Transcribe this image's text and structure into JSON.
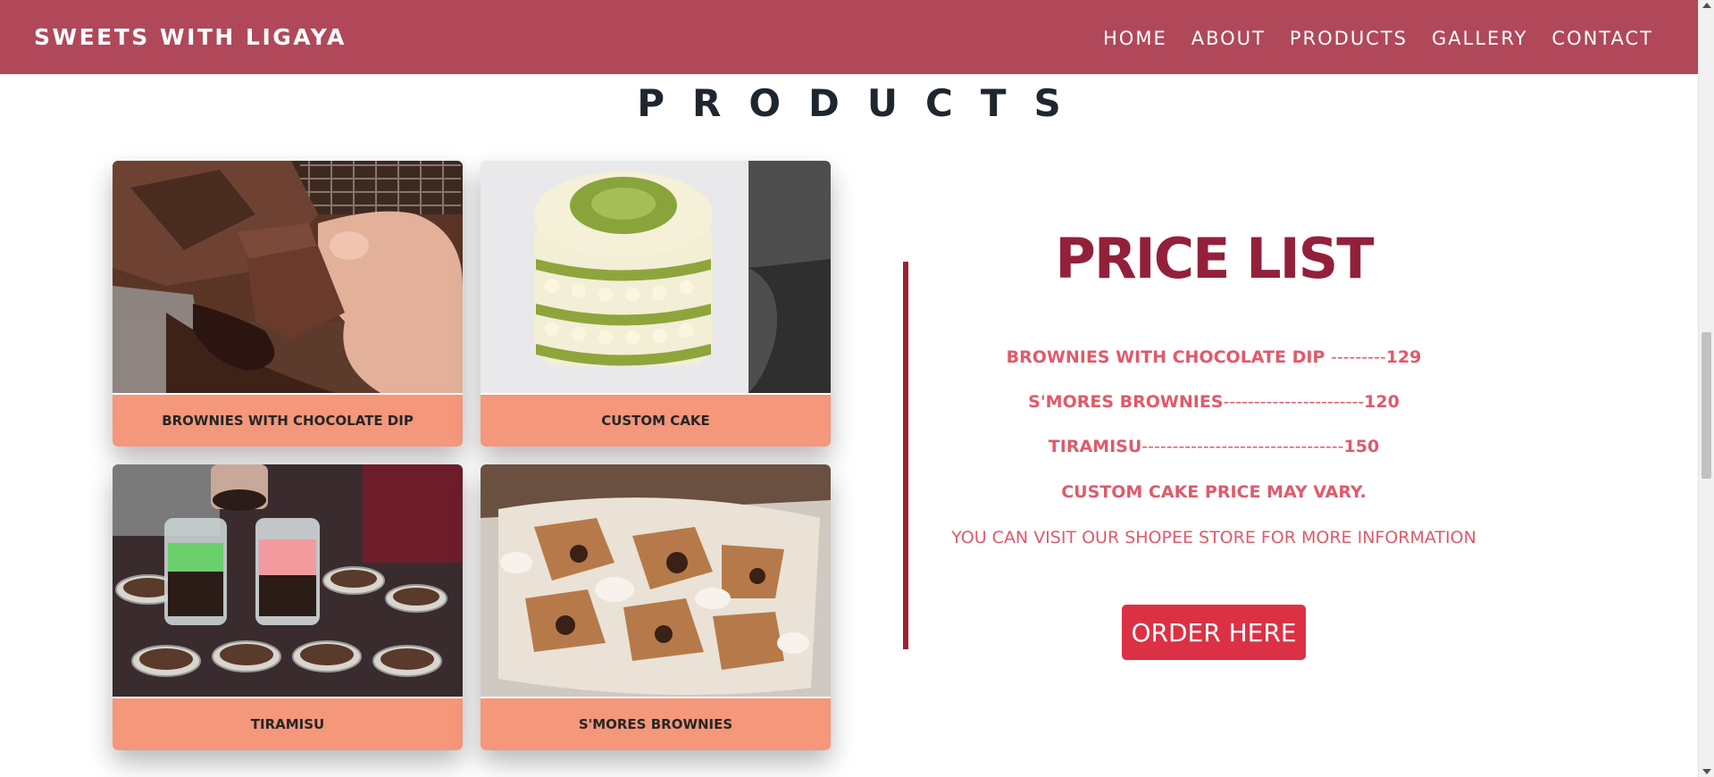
{
  "nav": {
    "brand": "SWEETS WITH LIGAYA",
    "links": [
      "HOME",
      "ABOUT",
      "PRODUCTS",
      "GALLERY",
      "CONTACT"
    ]
  },
  "products": {
    "title": "PRODUCTS",
    "cards": [
      {
        "name": "BROWNIES WITH CHOCOLATE DIP"
      },
      {
        "name": "CUSTOM CAKE"
      },
      {
        "name": "TIRAMISU"
      },
      {
        "name": "S'MORES BROWNIES"
      }
    ]
  },
  "price_list": {
    "title": "PRICE LIST",
    "items": [
      {
        "name": "BROWNIES WITH CHOCOLATE DIP ",
        "dashes": "---------",
        "price": "129"
      },
      {
        "name": "S'MORES BROWNIES",
        "dashes": "-----------------------",
        "price": "120"
      },
      {
        "name": "TIRAMISU",
        "dashes": "---------------------------------",
        "price": "150"
      }
    ],
    "note": "CUSTOM CAKE PRICE MAY VARY.",
    "info": "YOU CAN VISIT OUR SHOPEE STORE FOR MORE INFORMATION",
    "button": "ORDER HERE"
  },
  "colors": {
    "nav_bg": "#b0485a",
    "caption_bg": "#f4977a",
    "price_title": "#93203a",
    "price_text": "#e05a6a",
    "button_bg": "#dc3145"
  },
  "icons": [
    "scroll-up-arrow-icon",
    "scroll-down-arrow-icon"
  ]
}
